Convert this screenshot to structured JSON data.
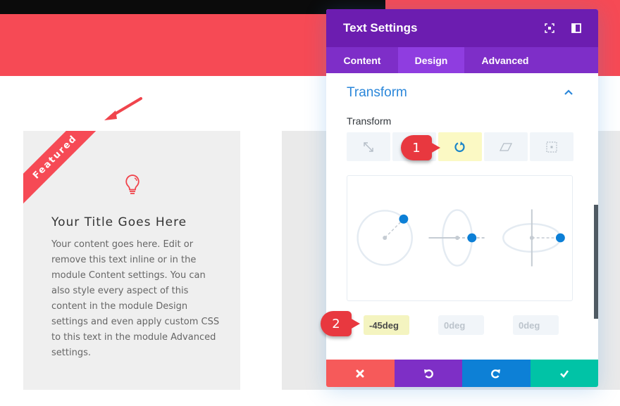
{
  "page": {
    "card": {
      "ribbon": "Featured",
      "icon": "lightbulb-icon",
      "title": "Your Title Goes Here",
      "body": "Your content goes here. Edit or remove this text inline or in the module Content settings. You can also style every aspect of this content in the module Design settings and even apply custom CSS to this text in the module Advanced settings."
    }
  },
  "modal": {
    "title": "Text Settings",
    "header_icons": [
      "expand-icon",
      "sidebar-layout-icon"
    ],
    "tabs": [
      {
        "label": "Content",
        "active": false
      },
      {
        "label": "Design",
        "active": true
      },
      {
        "label": "Advanced",
        "active": false
      }
    ],
    "section": {
      "title": "Transform",
      "expanded": true
    },
    "field_label": "Transform",
    "transform_buttons": [
      {
        "name": "scale-icon",
        "active": false
      },
      {
        "name": "translate-icon",
        "active": false
      },
      {
        "name": "rotate-icon",
        "active": true
      },
      {
        "name": "skew-icon",
        "active": false
      },
      {
        "name": "origin-icon",
        "active": false
      }
    ],
    "rotate_inputs": [
      {
        "value": "-45deg",
        "active": true
      },
      {
        "value": "0deg",
        "active": false
      },
      {
        "value": "0deg",
        "active": false
      }
    ],
    "footer": [
      "cancel",
      "undo",
      "redo",
      "save"
    ]
  },
  "annotations": {
    "step1": "1",
    "step2": "2"
  },
  "colors": {
    "accent_red": "#f64a55",
    "modal_purple": "#6c1db0",
    "tab_purple": "#7e2ec8",
    "active_tab": "#8f3de0",
    "link_blue": "#2b87da",
    "save_green": "#01c3a6"
  }
}
